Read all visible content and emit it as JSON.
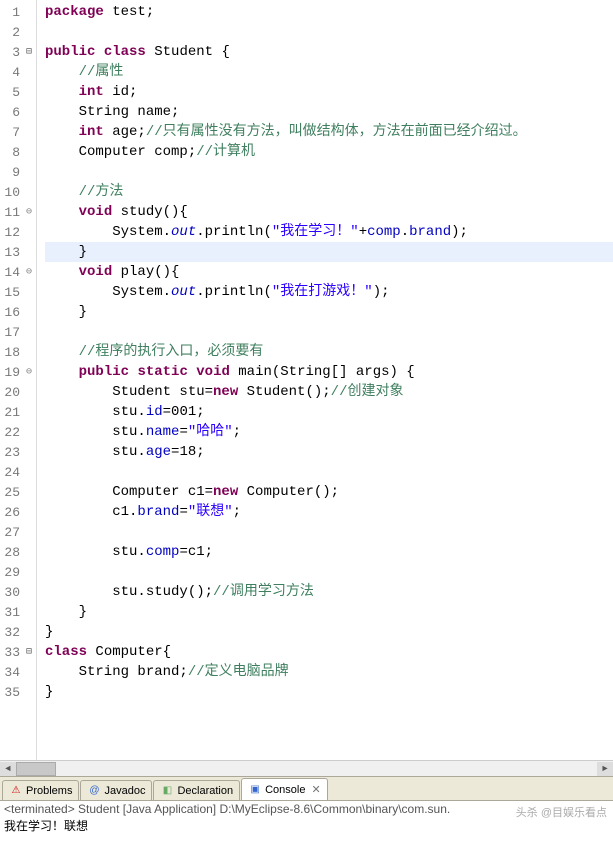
{
  "lines": [
    {
      "n": 1,
      "fold": "",
      "html": "<span class='kw'>package</span> test;"
    },
    {
      "n": 2,
      "fold": "",
      "html": ""
    },
    {
      "n": 3,
      "fold": "m",
      "html": "<span class='kw'>public</span> <span class='kw'>class</span> Student {"
    },
    {
      "n": 4,
      "fold": "",
      "html": "    <span class='cm'>//属性</span>"
    },
    {
      "n": 5,
      "fold": "",
      "html": "    <span class='kw'>int</span> id;"
    },
    {
      "n": 6,
      "fold": "",
      "html": "    String name;"
    },
    {
      "n": 7,
      "fold": "",
      "html": "    <span class='kw'>int</span> age;<span class='cm'>//只有属性没有方法，叫做结构体，方法在前面已经介绍过。</span>"
    },
    {
      "n": 8,
      "fold": "",
      "html": "    Computer comp;<span class='cm'>//计算机</span>"
    },
    {
      "n": 9,
      "fold": "",
      "html": ""
    },
    {
      "n": 10,
      "fold": "",
      "html": "    <span class='cm'>//方法</span>"
    },
    {
      "n": 11,
      "fold": "c",
      "html": "    <span class='kw'>void</span> study(){"
    },
    {
      "n": 12,
      "fold": "",
      "html": "        System.<span class='sfld'>out</span>.println(<span class='str'>\"我在学习！\"</span>+<span class='fld'>comp</span>.<span class='fld'>brand</span>);"
    },
    {
      "n": 13,
      "fold": "",
      "hl": true,
      "html": "    }"
    },
    {
      "n": 14,
      "fold": "c",
      "html": "    <span class='kw'>void</span> play(){"
    },
    {
      "n": 15,
      "fold": "",
      "html": "        System.<span class='sfld'>out</span>.println(<span class='str'>\"我在打游戏！\"</span>);"
    },
    {
      "n": 16,
      "fold": "",
      "html": "    }"
    },
    {
      "n": 17,
      "fold": "",
      "html": ""
    },
    {
      "n": 18,
      "fold": "",
      "html": "    <span class='cm'>//程序的执行入口，必须要有</span>"
    },
    {
      "n": 19,
      "fold": "c",
      "html": "    <span class='kw'>public</span> <span class='kw'>static</span> <span class='kw'>void</span> main(String[] args) {"
    },
    {
      "n": 20,
      "fold": "",
      "html": "        Student stu=<span class='kw'>new</span> Student();<span class='cm'>//创建对象</span>"
    },
    {
      "n": 21,
      "fold": "",
      "html": "        stu.<span class='fld'>id</span>=001;"
    },
    {
      "n": 22,
      "fold": "",
      "html": "        stu.<span class='fld'>name</span>=<span class='str'>\"哈哈\"</span>;"
    },
    {
      "n": 23,
      "fold": "",
      "html": "        stu.<span class='fld'>age</span>=18;"
    },
    {
      "n": 24,
      "fold": "",
      "html": ""
    },
    {
      "n": 25,
      "fold": "",
      "html": "        Computer c1=<span class='kw'>new</span> Computer();"
    },
    {
      "n": 26,
      "fold": "",
      "html": "        c1.<span class='fld'>brand</span>=<span class='str'>\"联想\"</span>;"
    },
    {
      "n": 27,
      "fold": "",
      "html": ""
    },
    {
      "n": 28,
      "fold": "",
      "html": "        stu.<span class='fld'>comp</span>=c1;"
    },
    {
      "n": 29,
      "fold": "",
      "html": ""
    },
    {
      "n": 30,
      "fold": "",
      "html": "        stu.study();<span class='cm'>//调用学习方法</span>"
    },
    {
      "n": 31,
      "fold": "",
      "html": "    }"
    },
    {
      "n": 32,
      "fold": "",
      "html": "}"
    },
    {
      "n": 33,
      "fold": "m",
      "html": "<span class='kw'>class</span> Computer{"
    },
    {
      "n": 34,
      "fold": "",
      "html": "    String brand;<span class='cm'>//定义电脑品牌</span>"
    },
    {
      "n": 35,
      "fold": "",
      "html": "}"
    }
  ],
  "tabs": [
    {
      "icon": "⚠",
      "color": "#c00",
      "label": "Problems"
    },
    {
      "icon": "@",
      "color": "#36c",
      "label": "Javadoc"
    },
    {
      "icon": "◧",
      "color": "#6a6",
      "label": "Declaration"
    },
    {
      "icon": "▣",
      "color": "#36c",
      "label": "Console",
      "active": true,
      "close": true
    }
  ],
  "console": {
    "terminated": "<terminated> Student [Java Application] D:\\MyEclipse-8.6\\Common\\binary\\com.sun.",
    "output": "我在学习！联想"
  },
  "watermark": "头杀 @目娱乐看点"
}
